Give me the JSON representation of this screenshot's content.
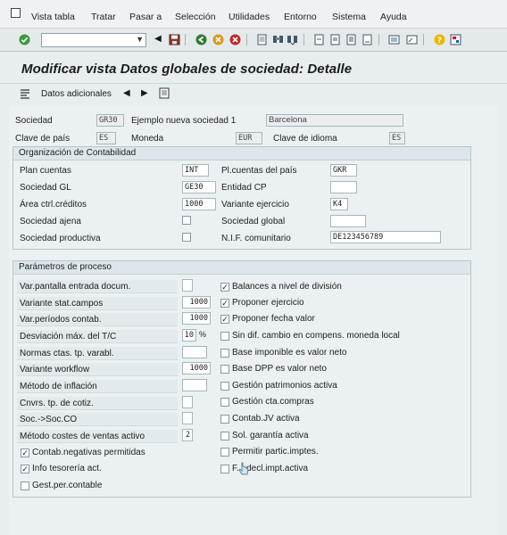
{
  "menu": [
    "Vista tabla",
    "Tratar",
    "Pasar a",
    "Selección",
    "Utilidades",
    "Entorno",
    "Sistema",
    "Ayuda"
  ],
  "title": "Modificar vista Datos globales de sociedad: Detalle",
  "app_toolbar": {
    "datos_adicionales": "Datos adicionales"
  },
  "header": {
    "sociedad_label": "Sociedad",
    "sociedad_value": "GR30",
    "sociedad_name": "Ejemplo nueva sociedad 1",
    "city": "Barcelona",
    "clave_pais_label": "Clave de país",
    "clave_pais_value": "ES",
    "moneda_label": "Moneda",
    "moneda_value": "EUR",
    "clave_idioma_label": "Clave de idioma",
    "clave_idioma_value": "ES"
  },
  "org": {
    "title": "Organización de Contabilidad",
    "plan_cuentas_label": "Plan cuentas",
    "plan_cuentas_value": "INT",
    "pl_cuentas_pais_label": "Pl.cuentas del país",
    "pl_cuentas_pais_value": "GKR",
    "sociedad_gl_label": "Sociedad GL",
    "sociedad_gl_value": "GE30",
    "entidad_cp_label": "Entidad CP",
    "entidad_cp_value": "",
    "area_label": "Área ctrl.créditos",
    "area_value": "1000",
    "variante_ejercicio_label": "Variante ejercicio",
    "variante_ejercicio_value": "K4",
    "sociedad_ajena_label": "Sociedad ajena",
    "sociedad_global_label": "Sociedad global",
    "sociedad_global_value": "",
    "sociedad_productiva_label": "Sociedad productiva",
    "nif_label": "N.I.F. comunitario",
    "nif_value": "DE123456789"
  },
  "proc": {
    "title": "Parámetros de proceso",
    "left": [
      {
        "label": "Var.pantalla entrada docum.",
        "value": ""
      },
      {
        "label": "Variante stat.campos",
        "value": "1000"
      },
      {
        "label": "Var.períodos contab.",
        "value": "1000"
      },
      {
        "label": "Desviación máx. del T/C",
        "value": "10",
        "unit": "%"
      },
      {
        "label": "Normas ctas. tp. varabl.",
        "value": ""
      },
      {
        "label": "Variante workflow",
        "value": "1000"
      },
      {
        "label": "Método de inflación",
        "value": ""
      },
      {
        "label": "Cnvrs. tp. de cotiz.",
        "value": ""
      },
      {
        "label": "Soc.->Soc.CO",
        "value": ""
      },
      {
        "label": "Método costes de ventas activo",
        "value": "2"
      }
    ],
    "left_checks": [
      {
        "label": "Contab.negativas permitidas",
        "checked": true
      },
      {
        "label": "Info tesorería act.",
        "checked": true
      },
      {
        "label": "Gest.per.contable",
        "checked": false
      }
    ],
    "right_checks": [
      {
        "label": "Balances a nivel de división",
        "checked": true
      },
      {
        "label": "Proponer ejercicio",
        "checked": true
      },
      {
        "label": "Proponer fecha valor",
        "checked": true
      },
      {
        "label": "Sin dif. cambio en compens. moneda local",
        "checked": false
      },
      {
        "label": "Base imponible es valor neto",
        "checked": false
      },
      {
        "label": "Base DPP es valor neto",
        "checked": false
      },
      {
        "label": "Gestión patrimonios activa",
        "checked": false
      },
      {
        "label": "Gestión cta.compras",
        "checked": false
      },
      {
        "label": "Contab.JV activa",
        "checked": false
      },
      {
        "label": "Sol. garantía activa",
        "checked": false
      },
      {
        "label": "Permitir partic.imptes.",
        "checked": false
      },
      {
        "label": "F... decl.impt.activa",
        "checked": false
      }
    ]
  },
  "check_mark": "✓"
}
